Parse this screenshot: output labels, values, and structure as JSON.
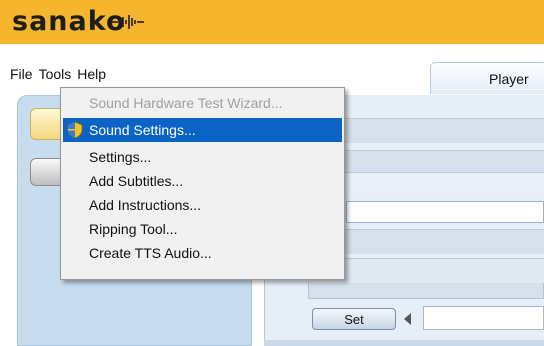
{
  "app": {
    "logo_text": "sanako",
    "logo_wave_icon": "sound-wave-icon",
    "brand_color": "#f5b52c"
  },
  "menubar": {
    "items": [
      "File",
      "Tools",
      "Help"
    ]
  },
  "tabs": [
    {
      "label": "Player"
    }
  ],
  "tools_menu": {
    "items": [
      {
        "label": "Sound Hardware Test Wizard...",
        "state": "disabled"
      },
      {
        "label": "Sound Settings...",
        "state": "highlighted",
        "icon": "shield-icon"
      },
      {
        "label": "Settings..."
      },
      {
        "label": "Add Subtitles..."
      },
      {
        "label": "Add Instructions..."
      },
      {
        "label": "Ripping Tool..."
      },
      {
        "label": "Create TTS Audio..."
      }
    ]
  },
  "player": {
    "set_button_label": "Set",
    "left_arrow_icon": "arrow-left-icon"
  }
}
